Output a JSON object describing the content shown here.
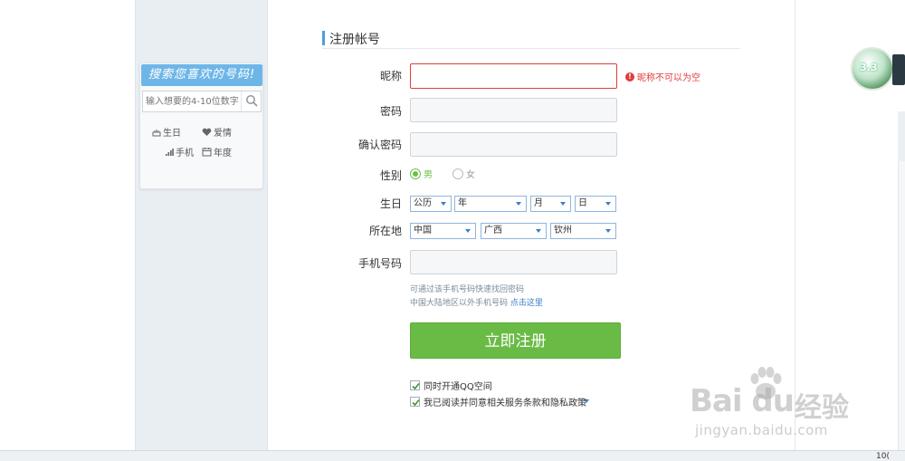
{
  "sidebar": {
    "banner": "搜索您喜欢的号码!",
    "search_placeholder": "输入想要的4-10位数字",
    "tags": [
      {
        "icon": "cake-icon",
        "label": "生日"
      },
      {
        "icon": "heart-icon",
        "label": "爱情"
      },
      {
        "icon": "signal-icon",
        "label": "手机"
      },
      {
        "icon": "calendar-icon",
        "label": "年度"
      }
    ]
  },
  "form": {
    "title": "注册帐号",
    "nickname_label": "昵称",
    "nickname_error": "昵称不可以为空",
    "password_label": "密码",
    "confirm_label": "确认密码",
    "gender_label": "性别",
    "gender_male": "男",
    "gender_female": "女",
    "birthday_label": "生日",
    "birthday": {
      "calendar": "公历",
      "year": "年",
      "month": "月",
      "day": "日"
    },
    "location_label": "所在地",
    "location": {
      "country": "中国",
      "province": "广西",
      "city": "钦州"
    },
    "phone_label": "手机号码",
    "phone_hint": "可通过该手机号码快速找回密码",
    "phone_hint2": "中国大陆地区以外手机号码",
    "phone_hint_link": "点击这里",
    "submit": "立即注册",
    "check_qzone": "同时开通QQ空间",
    "check_terms": "我已阅读并同意相关服务条款和隐私政策"
  },
  "widget": {
    "text": "3.3"
  },
  "watermark": {
    "logo": "Bai du",
    "cn": "经验",
    "url": "jingyan.baidu.com"
  },
  "statusbar": {
    "zoom": "10("
  },
  "colors": {
    "accent_green": "#69bb45",
    "error_red": "#e03c3c",
    "link_blue": "#3a7fc4",
    "banner_blue": "#6fb6e8"
  }
}
